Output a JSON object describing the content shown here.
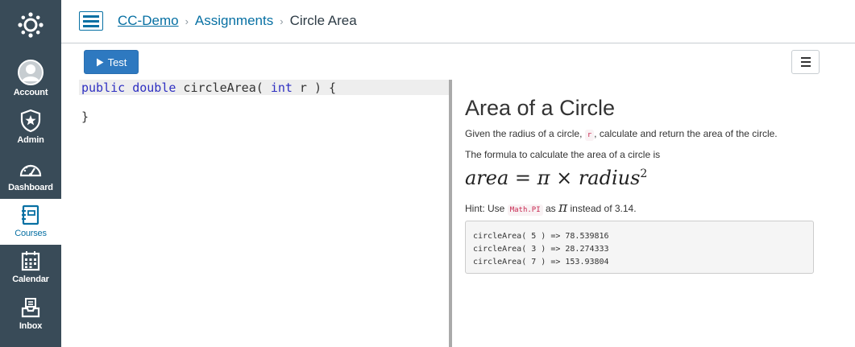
{
  "global_nav": {
    "items": [
      {
        "label": "Account",
        "icon": "account-icon"
      },
      {
        "label": "Admin",
        "icon": "admin-shield-icon"
      },
      {
        "label": "Dashboard",
        "icon": "dashboard-icon"
      },
      {
        "label": "Courses",
        "icon": "courses-icon",
        "active": true
      },
      {
        "label": "Calendar",
        "icon": "calendar-icon"
      },
      {
        "label": "Inbox",
        "icon": "inbox-icon"
      }
    ],
    "colors": {
      "background": "#394b58",
      "active_text": "#0770a3"
    }
  },
  "breadcrumb": {
    "course": "CC-Demo",
    "section": "Assignments",
    "current": "Circle Area"
  },
  "toolbar": {
    "test_label": "Test"
  },
  "editor": {
    "line1": {
      "kw1": "public",
      "kw2": "double",
      "name": " circleArea( ",
      "kw3": "int",
      "rest": " r ) {"
    },
    "line2": "}"
  },
  "instructions": {
    "title": "Area of a Circle",
    "p1_before": "Given the radius of a circle, ",
    "p1_code": "r",
    "p1_after": ", calculate and return the area of the circle.",
    "p2": "The formula to calculate the area of a circle is",
    "formula": {
      "lhs": "area",
      "eq": " = ",
      "pi": "π",
      "times": " × ",
      "rhs": "radius",
      "exp": "2"
    },
    "hint_before": "Hint: Use ",
    "hint_code": "Math.PI",
    "hint_mid": " as ",
    "hint_pi": "π",
    "hint_after": " instead of 3.14.",
    "examples": [
      "circleArea( 5 ) => 78.539816",
      "circleArea( 3 ) => 28.274333",
      "circleArea( 7 ) => 153.93804"
    ]
  }
}
